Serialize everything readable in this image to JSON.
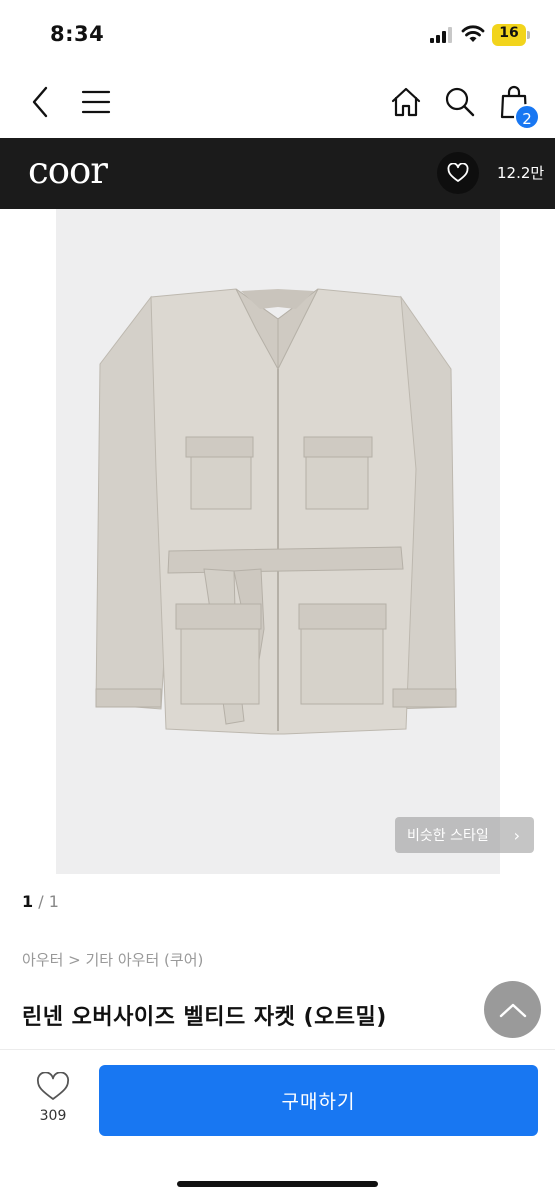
{
  "status_bar": {
    "time": "8:34",
    "battery_level": "16"
  },
  "nav": {
    "icons": [
      "chevron-left-icon",
      "menu-icon",
      "home-icon",
      "search-icon",
      "shopping-bag-icon"
    ],
    "cart_badge": "2"
  },
  "brand": {
    "name": "coor",
    "like_count": "12.2만"
  },
  "gallery": {
    "similar_style_label": "비슷한 스타일",
    "page_current": "1",
    "page_separator": "/",
    "page_total": "1"
  },
  "product": {
    "breadcrumb": "아우터 > 기타 아우터 (쿠어)",
    "title": "린넨 오버사이즈 벨티드 자켓 (오트밀)"
  },
  "bottom": {
    "wish_count": "309",
    "buy_label": "구매하기"
  },
  "colors": {
    "accent": "#1877f2",
    "brand_bar": "#1b1b1b",
    "jacket": "#d9d5ce"
  }
}
